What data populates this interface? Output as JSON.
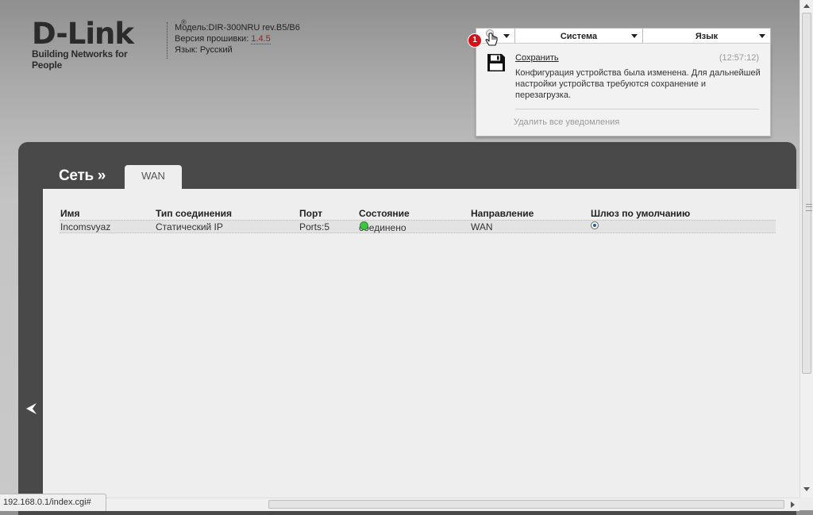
{
  "header": {
    "logo_text": "D-Link",
    "logo_reg": "®",
    "logo_tagline": "Building Networks for People",
    "model_label": "Модель:",
    "model_value": "DIR-300NRU rev.B5/B6",
    "firmware_label": "Версия прошивки: ",
    "firmware_value": "1.4.5",
    "language_label": "Язык: ",
    "language_value": "Русский"
  },
  "topbar": {
    "notification_count": "1",
    "system_label": "Система",
    "language_menu_label": "Язык"
  },
  "notification": {
    "title": "Сохранить",
    "time": "(12:57:12)",
    "text": "Конфигурация устройства была изменена. Для дальнейшей настройки устройства требуются сохранение и перезагрузка.",
    "clear_all": "Удалить все уведомления"
  },
  "page": {
    "section_title": "Сеть »",
    "active_tab": "WAN"
  },
  "table": {
    "headers": [
      "Имя",
      "Тип соединения",
      "Порт",
      "Состояние",
      "Направление",
      "Шлюз по умолчанию"
    ],
    "rows": [
      {
        "name": "Incomsvyaz",
        "type": "Статический IP",
        "port": "Ports:5",
        "status": "соединено",
        "direction": "WAN",
        "default_gateway": true
      }
    ]
  },
  "statusbar": {
    "url": "192.168.0.1/index.cgi#"
  },
  "icons": {
    "notifications": "hand-pointer-icon",
    "save": "floppy-disk-icon",
    "back": "chevron-left-icon",
    "status": "status-dot-icon"
  },
  "colors": {
    "status_connected": "#3fc63f",
    "badge": "#d6101a",
    "firmware_link": "#b01818",
    "panel_dark": "#494949"
  }
}
